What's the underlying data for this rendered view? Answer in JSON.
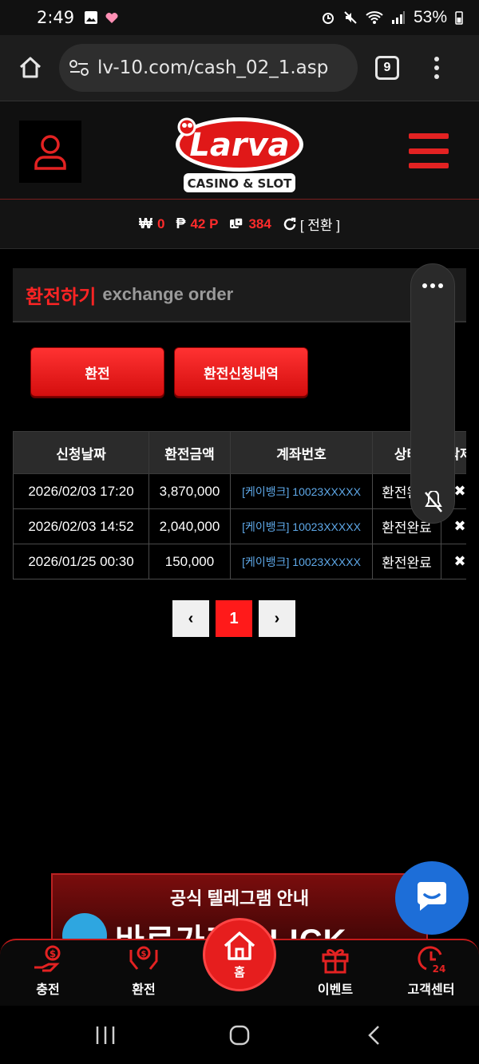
{
  "status_bar": {
    "time": "2:49",
    "battery": "53%"
  },
  "browser": {
    "url": "lv-10.com/cash_02_1.asp",
    "tab_count": "9"
  },
  "header": {
    "logo_text": "Larva",
    "logo_sub": "CASINO & SLOT"
  },
  "balance": {
    "cash_symbol": "₩",
    "cash": "0",
    "point_symbol": "₱",
    "points": "42 P",
    "chip_count": "384",
    "convert_label": "[ 전환 ]"
  },
  "section": {
    "title_ko": "환전하기",
    "title_en": "exchange order"
  },
  "buttons": {
    "exchange": "환전",
    "history": "환전신청내역"
  },
  "table": {
    "headers": [
      "신청날짜",
      "환전금액",
      "계좌번호",
      "상태",
      "삭제"
    ],
    "rows": [
      {
        "date": "2026/02/03 17:20",
        "amount": "3,870,000",
        "account": "[케이뱅크] 10023XXXXX",
        "status": "환전완료",
        "del": "✖"
      },
      {
        "date": "2026/02/03 14:52",
        "amount": "2,040,000",
        "account": "[케이뱅크] 10023XXXXX",
        "status": "환전완료",
        "del": "✖"
      },
      {
        "date": "2026/01/25 00:30",
        "amount": "150,000",
        "account": "[케이뱅크] 10023XXXXX",
        "status": "환전완료",
        "del": "✖"
      }
    ]
  },
  "pagination": {
    "prev": "‹",
    "current": "1",
    "next": "›"
  },
  "banner": {
    "title": "공식 텔레그램 안내",
    "big": "바로가기 CLICK"
  },
  "bottom_nav": {
    "charge": "충전",
    "exchange": "환전",
    "home": "홈",
    "event": "이벤트",
    "support": "고객센터"
  },
  "colors": {
    "accent": "#ff1a1a",
    "link": "#5ea8e8",
    "chat": "#1d6ed8"
  }
}
